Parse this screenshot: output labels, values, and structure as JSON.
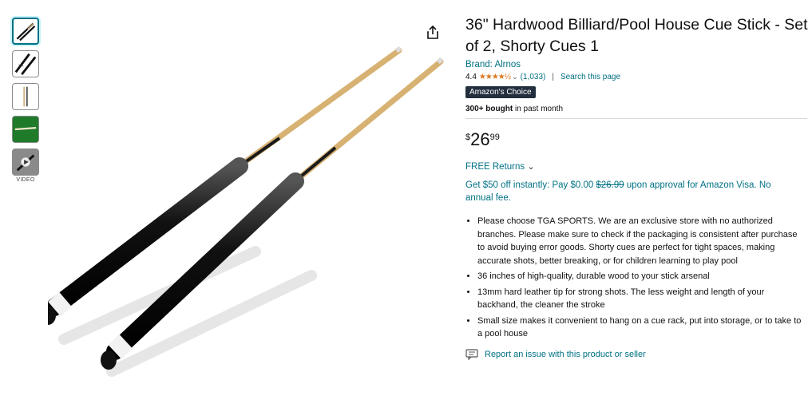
{
  "thumbnails": [
    {
      "name": "thumbnail-1",
      "selected": true
    },
    {
      "name": "thumbnail-2",
      "selected": false
    },
    {
      "name": "thumbnail-3",
      "selected": false
    },
    {
      "name": "thumbnail-4",
      "selected": false
    },
    {
      "name": "thumbnail-5",
      "selected": false
    }
  ],
  "video_label": "VIDEO",
  "product": {
    "title": "36\" Hardwood Billiard/Pool House Cue Stick - Set of 2, Shorty Cues 1",
    "brand": "Brand: Alrnos",
    "rating": "4.4",
    "ratings_count": "(1,033)",
    "search_link": "Search this page",
    "badge": "Amazon's Choice",
    "bought_bold": "300+ bought",
    "bought_rest": " in past month",
    "price_symbol": "$",
    "price_whole": "26",
    "price_fraction": "99",
    "returns": "FREE Returns",
    "promo_a": "Get $50 off instantly: Pay $0.00 ",
    "promo_strike": "$26.99",
    "promo_b": " upon approval for Amazon Visa. No annual fee.",
    "bullets": [
      "Please choose TGA SPORTS. We are an exclusive store with no authorized branches. Please make sure to check if the packaging is consistent after purchase to avoid buying error goods. Shorty cues are perfect for tight spaces, making accurate shots, better breaking, or for children learning to play pool",
      "36 inches of high-quality, durable wood to your stick arsenal",
      "13mm hard leather tip for strong shots. The less weight and length of your backhand, the cleaner the stroke",
      "Small size makes it convenient to hang on a cue rack, put into storage, or to take to a pool house"
    ],
    "report": "Report an issue with this product or seller"
  },
  "icons": {
    "share": "share-icon",
    "stars": "star-rating-icon",
    "chevron": "chevron-down-icon",
    "report": "report-icon"
  },
  "colors": {
    "link": "#007185",
    "star": "#de7921",
    "badge_bg": "#232f3e"
  }
}
